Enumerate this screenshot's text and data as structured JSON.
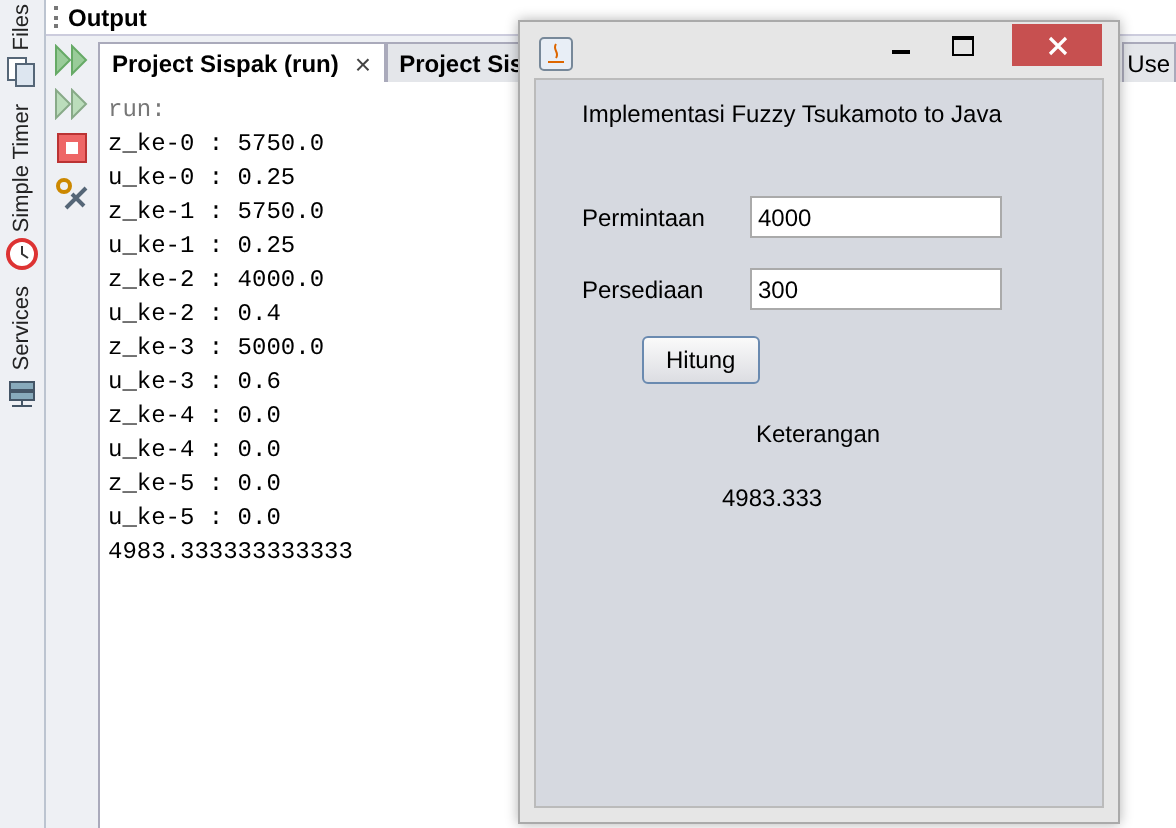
{
  "side_tabs": [
    {
      "label": "Files"
    },
    {
      "label": "Simple Timer"
    },
    {
      "label": "Services"
    }
  ],
  "output": {
    "title": "Output",
    "tabs": [
      {
        "label": "Project Sispak (run)",
        "selected": true,
        "close": "×"
      },
      {
        "label": "Project Sis",
        "selected": false
      },
      {
        "label": "Use",
        "selected": false
      }
    ],
    "lines": [
      {
        "text": "run:",
        "kind": "meta"
      },
      {
        "text": "z_ke-0 : 5750.0",
        "kind": "out"
      },
      {
        "text": "u_ke-0 : 0.25",
        "kind": "out"
      },
      {
        "text": "z_ke-1 : 5750.0",
        "kind": "out"
      },
      {
        "text": "u_ke-1 : 0.25",
        "kind": "out"
      },
      {
        "text": "z_ke-2 : 4000.0",
        "kind": "out"
      },
      {
        "text": "u_ke-2 : 0.4",
        "kind": "out"
      },
      {
        "text": "z_ke-3 : 5000.0",
        "kind": "out"
      },
      {
        "text": "u_ke-3 : 0.6",
        "kind": "out"
      },
      {
        "text": "z_ke-4 : 0.0",
        "kind": "out"
      },
      {
        "text": "u_ke-4 : 0.0",
        "kind": "out"
      },
      {
        "text": "z_ke-5 : 0.0",
        "kind": "out"
      },
      {
        "text": "u_ke-5 : 0.0",
        "kind": "out"
      },
      {
        "text": "4983.333333333333",
        "kind": "out"
      }
    ]
  },
  "dialog": {
    "heading": "Implementasi Fuzzy Tsukamoto to Java",
    "fields": [
      {
        "label": "Permintaan",
        "value": "4000"
      },
      {
        "label": "Persediaan",
        "value": "300"
      }
    ],
    "button": "Hitung",
    "result_label": "Keterangan",
    "result": "4983.333"
  }
}
